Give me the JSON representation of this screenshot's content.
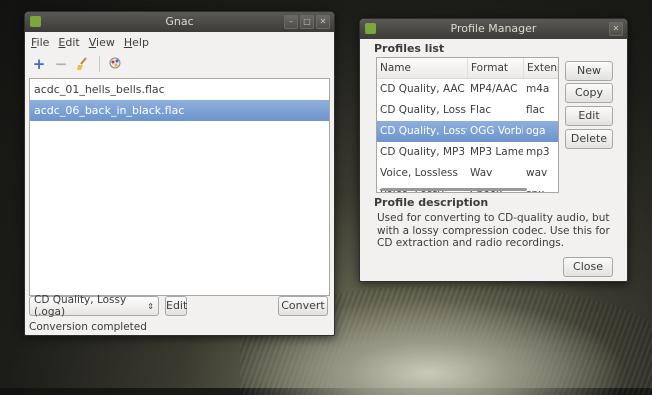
{
  "gnac": {
    "title": "Gnac",
    "menu": [
      "File",
      "Edit",
      "View",
      "Help"
    ],
    "toolbar": {
      "add_icon": "plus-icon",
      "remove_icon": "minus-icon",
      "clear_icon": "broom-icon",
      "prefs_icon": "preferences-icon"
    },
    "files": [
      {
        "name": "acdc_01_hells_bells.flac",
        "selected": false
      },
      {
        "name": "acdc_06_back_in_black.flac",
        "selected": true
      }
    ],
    "profile_select": "CD Quality, Lossy (.oga)",
    "edit_label": "Edit",
    "convert_label": "Convert",
    "status": "Conversion completed"
  },
  "pm": {
    "title": "Profile Manager",
    "profiles_list_title": "Profiles list",
    "columns": [
      "Name",
      "Format",
      "Extensi"
    ],
    "profiles": [
      {
        "name": "CD Quality, AAC",
        "format": "MP4/AAC",
        "ext": "m4a",
        "selected": false
      },
      {
        "name": "CD Quality, Lossless",
        "format": "Flac",
        "ext": "flac",
        "selected": false
      },
      {
        "name": "CD Quality, Lossy",
        "format": "OGG Vorbis",
        "ext": "oga",
        "selected": true
      },
      {
        "name": "CD Quality, MP3",
        "format": "MP3 Lame",
        "ext": "mp3",
        "selected": false
      },
      {
        "name": "Voice, Lossless",
        "format": "Wav",
        "ext": "wav",
        "selected": false
      },
      {
        "name": "Voice, Lossy",
        "format": "Speex",
        "ext": "spx",
        "selected": false
      }
    ],
    "buttons": {
      "new": "New",
      "copy": "Copy",
      "edit": "Edit",
      "delete": "Delete",
      "close": "Close"
    },
    "description_title": "Profile description",
    "description": "Used for converting to CD-quality audio, but with a lossy compression codec. Use this for CD extraction and radio recordings."
  },
  "colors": {
    "selection": "#6d94cc",
    "titlebar": "#3c3b37",
    "window_bg": "#f2f1f0"
  }
}
